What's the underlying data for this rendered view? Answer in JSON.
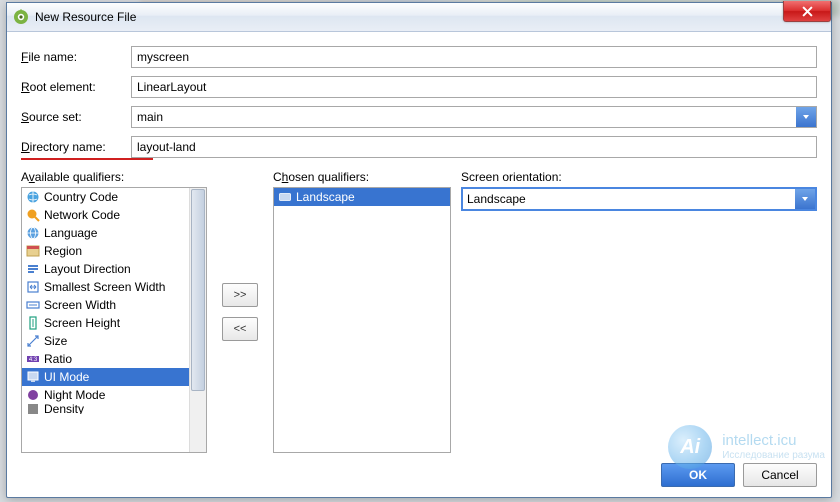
{
  "titlebar": {
    "title": "New Resource File"
  },
  "form": {
    "file_name": {
      "label_u": "F",
      "label_rest": "ile name:",
      "value": "myscreen"
    },
    "root_element": {
      "label_u": "R",
      "label_rest": "oot element:",
      "value": "LinearLayout"
    },
    "source_set": {
      "label_u": "S",
      "label_rest": "ource set:",
      "value": "main"
    },
    "directory_name": {
      "label_u": "D",
      "label_rest": "irectory name:",
      "value": "layout-land"
    }
  },
  "qualifiers": {
    "available_label_pre": "A",
    "available_label_u": "v",
    "available_label_post": "ailable qualifiers:",
    "chosen_label_pre": "C",
    "chosen_label_u": "h",
    "chosen_label_post": "osen qualifiers:",
    "btn_add": ">>",
    "btn_remove": "<<",
    "available": [
      "Country Code",
      "Network Code",
      "Language",
      "Region",
      "Layout Direction",
      "Smallest Screen Width",
      "Screen Width",
      "Screen Height",
      "Size",
      "Ratio",
      "UI Mode",
      "Night Mode",
      "Density"
    ],
    "selected_available_index": 10,
    "chosen": [
      "Landscape"
    ]
  },
  "config": {
    "orientation_label": "Screen orientation:",
    "orientation_value": "Landscape"
  },
  "buttons": {
    "ok": "OK",
    "cancel": "Cancel"
  },
  "watermark": {
    "logo_text": "Ai",
    "line1": "intellect.icu",
    "line2": "Исследование разума"
  },
  "colors": {
    "selection": "#3874d0",
    "accent_red": "#d02020",
    "primary_button": "#2e6ed0"
  }
}
